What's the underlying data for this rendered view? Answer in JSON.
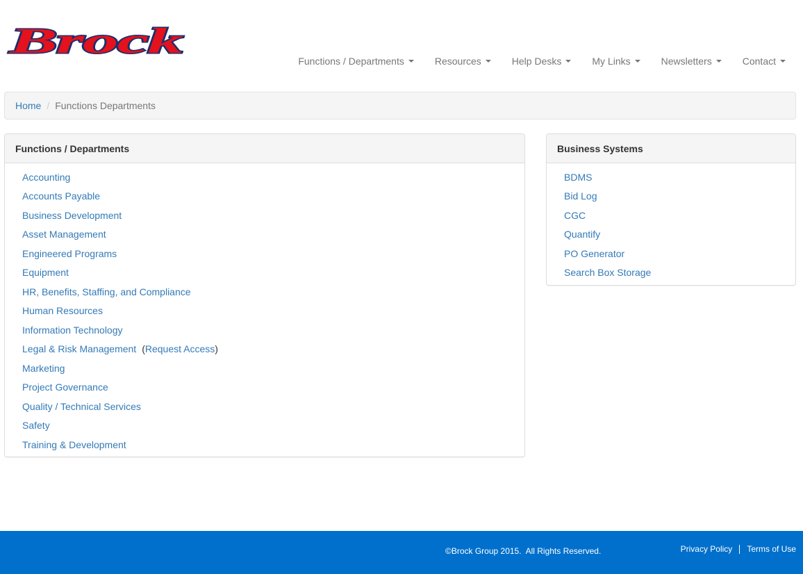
{
  "brand": {
    "logo_text": "Brock",
    "logo_color": "#e3121d",
    "logo_outline": "#1b2f6e"
  },
  "nav": {
    "items": [
      {
        "label": "Functions / Departments"
      },
      {
        "label": "Resources"
      },
      {
        "label": "Help Desks"
      },
      {
        "label": "My Links"
      },
      {
        "label": "Newsletters"
      },
      {
        "label": "Contact"
      }
    ]
  },
  "breadcrumb": {
    "home": "Home",
    "current": "Functions Departments"
  },
  "functions_panel": {
    "title": "Functions / Departments",
    "items": [
      "Accounting",
      "Accounts Payable",
      "Business Development",
      "Asset Management",
      "Engineered Programs",
      "Equipment",
      "HR, Benefits, Staffing, and Compliance",
      "Human Resources",
      "Information Technology",
      "Legal & Risk Management",
      "Marketing",
      "Project Governance",
      "Quality / Technical Services",
      "Safety",
      "Training & Development"
    ],
    "request_access": "Request Access",
    "open_paren": "(",
    "close_paren": ")"
  },
  "systems_panel": {
    "title": "Business Systems",
    "items": [
      "BDMS",
      "Bid Log",
      "CGC",
      "Quantify",
      "PO Generator",
      "Search Box Storage"
    ]
  },
  "footer": {
    "copyright": "©Brock Group 2015.  All Rights Reserved.",
    "privacy": "Privacy Policy",
    "terms": "Terms of Use",
    "background": "#0070cc"
  }
}
